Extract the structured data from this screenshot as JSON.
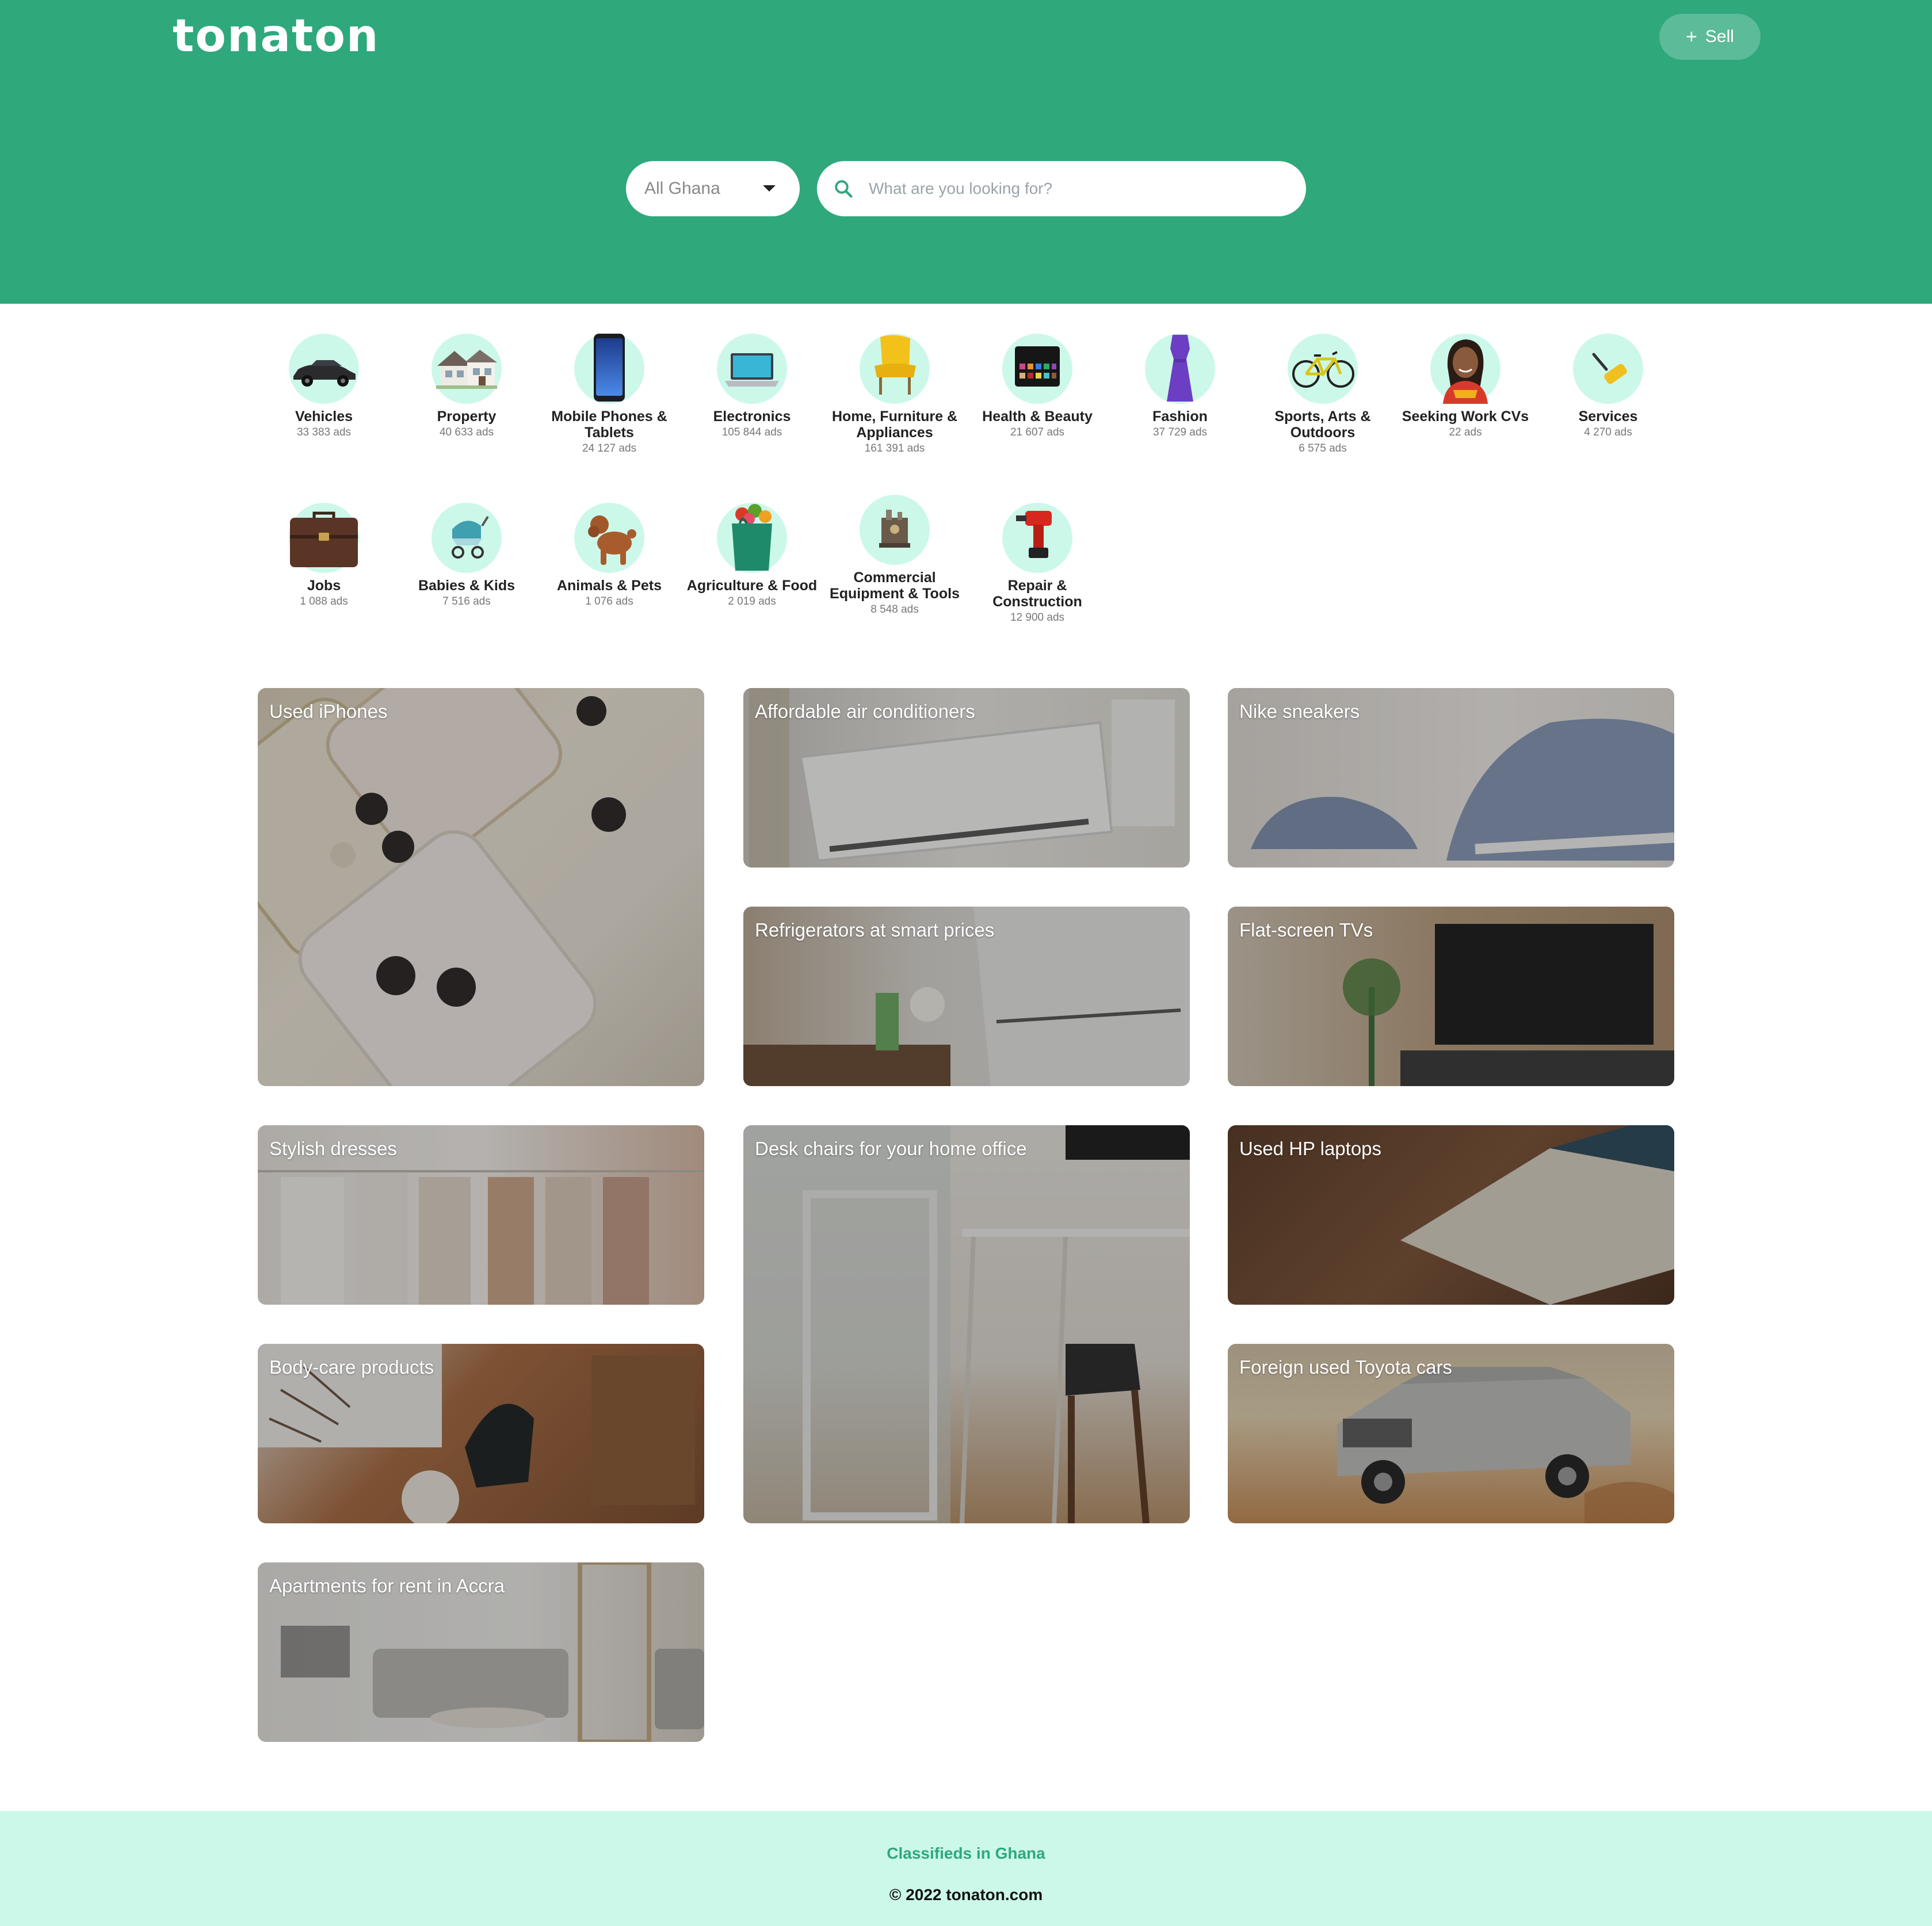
{
  "header": {
    "logo": "tonaton",
    "sell_label": "Sell",
    "region": "All Ghana",
    "search_placeholder": "What are you looking for?"
  },
  "colors": {
    "brand": "#2fa87c",
    "mint": "#ccf8ea"
  },
  "categories": [
    {
      "name": "Vehicles",
      "count": "33 383 ads",
      "icon": "car-icon"
    },
    {
      "name": "Property",
      "count": "40 633 ads",
      "icon": "house-icon"
    },
    {
      "name": "Mobile Phones & Tablets",
      "count": "24 127 ads",
      "icon": "smartphone-icon"
    },
    {
      "name": "Electronics",
      "count": "105 844 ads",
      "icon": "laptop-icon"
    },
    {
      "name": "Home, Furniture & Appliances",
      "count": "161 391 ads",
      "icon": "armchair-icon"
    },
    {
      "name": "Health & Beauty",
      "count": "21 607 ads",
      "icon": "eyeshadow-palette-icon"
    },
    {
      "name": "Fashion",
      "count": "37 729 ads",
      "icon": "dress-icon"
    },
    {
      "name": "Sports, Arts & Outdoors",
      "count": "6 575 ads",
      "icon": "bicycle-icon"
    },
    {
      "name": "Seeking Work CVs",
      "count": "22 ads",
      "icon": "person-icon"
    },
    {
      "name": "Services",
      "count": "4 270 ads",
      "icon": "paint-roller-icon"
    },
    {
      "name": "Jobs",
      "count": "1 088 ads",
      "icon": "briefcase-icon"
    },
    {
      "name": "Babies & Kids",
      "count": "7 516 ads",
      "icon": "stroller-icon"
    },
    {
      "name": "Animals & Pets",
      "count": "1 076 ads",
      "icon": "dog-icon"
    },
    {
      "name": "Agriculture & Food",
      "count": "2 019 ads",
      "icon": "grocery-bag-icon"
    },
    {
      "name": "Commercial Equipment & Tools",
      "count": "8 548 ads",
      "icon": "machine-icon"
    },
    {
      "name": "Repair & Construction",
      "count": "12 900 ads",
      "icon": "drill-icon"
    }
  ],
  "promos": [
    {
      "label": "Used iPhones"
    },
    {
      "label": "Affordable air conditioners"
    },
    {
      "label": "Nike sneakers"
    },
    {
      "label": "Refrigerators at smart prices"
    },
    {
      "label": "Flat-screen TVs"
    },
    {
      "label": "Stylish dresses"
    },
    {
      "label": "Desk chairs for your home office"
    },
    {
      "label": "Used HP laptops"
    },
    {
      "label": "Body-care products"
    },
    {
      "label": "Foreign used Toyota cars"
    },
    {
      "label": "Apartments for rent in Accra"
    }
  ],
  "footer": {
    "tagline": "Classifieds in Ghana",
    "copyright": "© 2022 tonaton.com"
  }
}
